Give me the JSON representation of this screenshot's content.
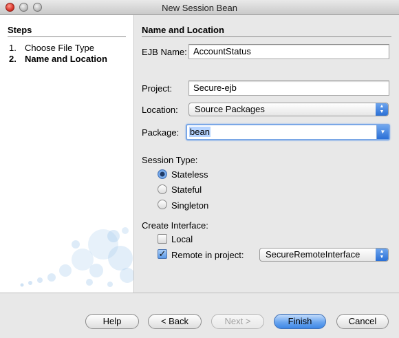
{
  "window": {
    "title": "New Session Bean"
  },
  "steps": {
    "heading": "Steps",
    "items": [
      {
        "num": "1.",
        "label": "Choose File Type"
      },
      {
        "num": "2.",
        "label": "Name and Location"
      }
    ]
  },
  "form": {
    "heading": "Name and Location",
    "ejb_name": {
      "label": "EJB Name:",
      "value": "AccountStatus"
    },
    "project": {
      "label": "Project:",
      "value": "Secure-ejb"
    },
    "location": {
      "label": "Location:",
      "value": "Source Packages"
    },
    "package": {
      "label": "Package:",
      "value": "bean"
    },
    "session_type": {
      "label": "Session Type:",
      "options": [
        "Stateless",
        "Stateful",
        "Singleton"
      ],
      "selected": "Stateless"
    },
    "create_interface": {
      "label": "Create Interface:",
      "local": {
        "label": "Local",
        "checked": false
      },
      "remote": {
        "label": "Remote in project:",
        "checked": true,
        "project": "SecureRemoteInterface"
      }
    }
  },
  "buttons": {
    "help": "Help",
    "back": "< Back",
    "next": "Next >",
    "finish": "Finish",
    "cancel": "Cancel"
  },
  "colors": {
    "accent": "#3d86e6",
    "selection": "#b5d3ff"
  }
}
